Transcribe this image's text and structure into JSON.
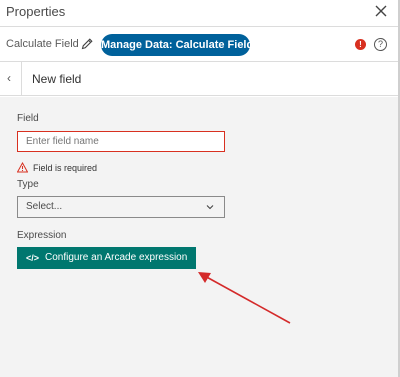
{
  "titlebar": {
    "title": "Properties",
    "close_icon": "close-icon"
  },
  "toolbar": {
    "tool_name": "Calculate Field",
    "pencil_icon": "pencil-icon",
    "pill_label": "Manage Data: Calculate Field",
    "error_icon": "error-icon",
    "error_glyph": "!",
    "help_icon": "help-icon",
    "help_glyph": "?"
  },
  "subheader": {
    "back_glyph": "‹",
    "title": "New field"
  },
  "form": {
    "field_label": "Field",
    "field_placeholder": "Enter field name",
    "field_value": "",
    "error_text": "Field is required",
    "type_label": "Type",
    "type_selected": "Select...",
    "expression_label": "Expression",
    "arcade_button_glyph": "</>",
    "arcade_button_label": "Configure an Arcade expression"
  },
  "colors": {
    "brand_blue": "#00619b",
    "arcade_green": "#00776f",
    "error_red": "#d83020",
    "annotation_arrow": "#d42a2a"
  }
}
